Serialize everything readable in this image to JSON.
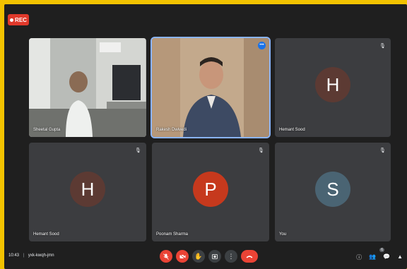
{
  "recording": {
    "label": "REC"
  },
  "tiles": [
    {
      "name": "Sheetal Gupta",
      "type": "video"
    },
    {
      "name": "Rakesh Dwivedi",
      "type": "video"
    },
    {
      "name": "Hemant Sood",
      "type": "avatar",
      "initial": "H",
      "color": "#5c3a33"
    },
    {
      "name": "Hemant Sood",
      "type": "avatar",
      "initial": "H",
      "color": "#5c3a33"
    },
    {
      "name": "Poonam Sharma",
      "type": "avatar",
      "initial": "P",
      "color": "#c6391d"
    },
    {
      "name": "You",
      "type": "avatar",
      "initial": "S",
      "color": "#4a6473"
    }
  ],
  "bottom": {
    "time": "10:43",
    "meeting_code": "yxk-kwqh-jmn",
    "participants_count": "6"
  },
  "colors": {
    "frame": "#f2c200",
    "background": "#1f1f1f",
    "tile": "#3c3d40",
    "danger": "#ea4335"
  }
}
